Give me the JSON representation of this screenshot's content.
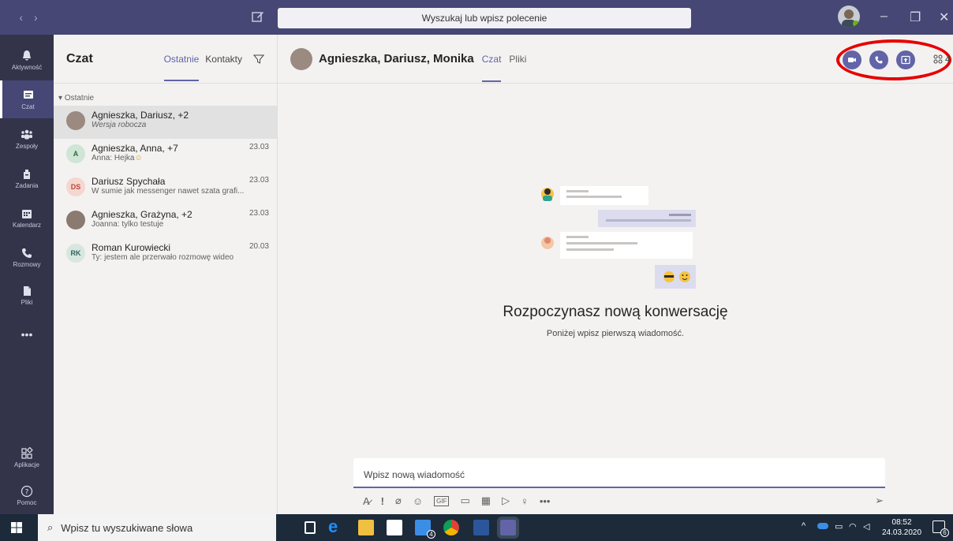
{
  "titlebar": {
    "search_placeholder": "Wyszukaj lub wpisz polecenie",
    "nav_back": "‹",
    "nav_forward": "›",
    "minimize": "–",
    "maximize": "❐",
    "close": "✕"
  },
  "rail": {
    "items": [
      {
        "label": "Aktywność",
        "icon": "bell-icon"
      },
      {
        "label": "Czat",
        "icon": "chat-icon"
      },
      {
        "label": "Zespoły",
        "icon": "teams-icon"
      },
      {
        "label": "Zadania",
        "icon": "tasks-icon"
      },
      {
        "label": "Kalendarz",
        "icon": "calendar-icon"
      },
      {
        "label": "Rozmowy",
        "icon": "phone-icon"
      },
      {
        "label": "Pliki",
        "icon": "file-icon"
      }
    ],
    "more": "•••",
    "bottom": [
      {
        "label": "Aplikacje",
        "icon": "apps-icon"
      },
      {
        "label": "Pomoc",
        "icon": "help-icon"
      }
    ],
    "active_index": 1
  },
  "chatlist": {
    "title": "Czat",
    "tabs": [
      "Ostatnie",
      "Kontakty"
    ],
    "section": "Ostatnie",
    "items": [
      {
        "name": "Agnieszka, Dariusz, +2",
        "preview": "Wersja robocza",
        "date": "",
        "avatar_text": "",
        "selected": true
      },
      {
        "name": "Agnieszka, Anna, +7",
        "preview": "Anna: Hejka",
        "date": "23.03",
        "avatar_text": "A"
      },
      {
        "name": "Dariusz Spychała",
        "preview": "W sumie jak messenger nawet szata grafi...",
        "date": "23.03",
        "avatar_text": "DS"
      },
      {
        "name": "Agnieszka, Grażyna, +2",
        "preview": "Joanna: tylko testuje",
        "date": "23.03",
        "avatar_text": ""
      },
      {
        "name": "Roman Kurowiecki",
        "preview": "Ty: jestem ale przerwało rozmowę wideo",
        "date": "20.03",
        "avatar_text": "RK"
      }
    ]
  },
  "conversation": {
    "title": "Agnieszka, Dariusz, Monika",
    "tabs": [
      "Czat",
      "Pliki"
    ],
    "participants_count": "4",
    "empty_title": "Rozpoczynasz nową konwersację",
    "empty_sub": "Poniżej wpisz pierwszą wiadomość.",
    "compose_placeholder": "Wpisz nową wiadomość"
  },
  "taskbar": {
    "search_placeholder": "Wpisz tu wyszukiwane słowa",
    "time": "08:52",
    "date": "24.03.2020",
    "mail_badge": "4",
    "notif_badge": "6"
  },
  "colors": {
    "accent": "#6264a7",
    "rail_bg": "#33344a",
    "titlebar_bg": "#464775",
    "highlight_ring": "#e60000"
  }
}
